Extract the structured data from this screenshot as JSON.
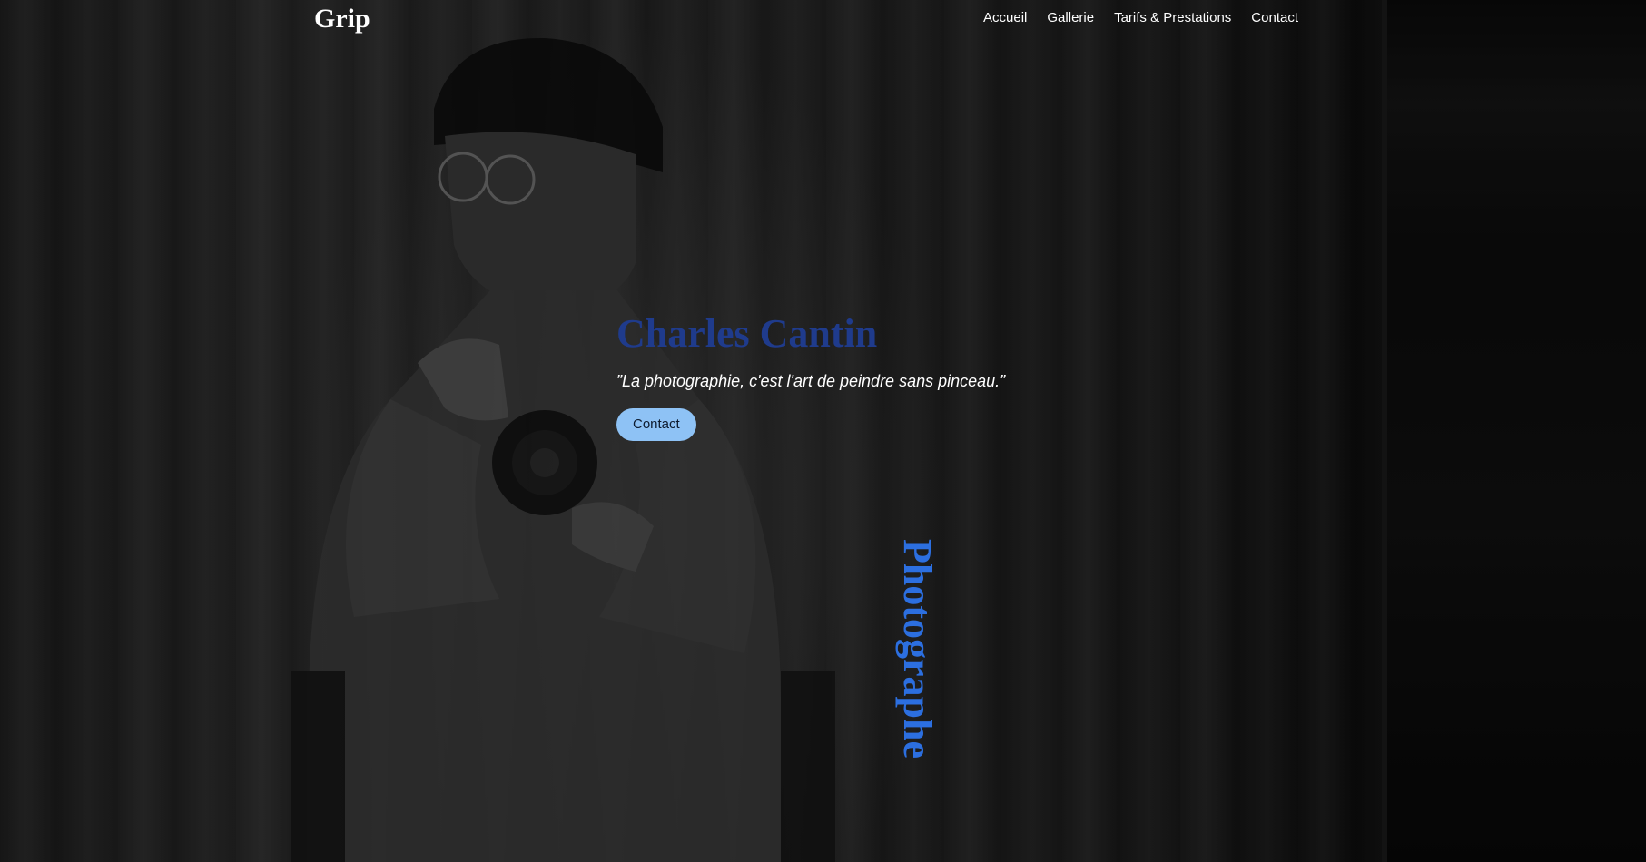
{
  "site": {
    "logo": "Grip"
  },
  "nav": {
    "items": [
      {
        "label": "Accueil"
      },
      {
        "label": "Gallerie"
      },
      {
        "label": "Tarifs & Prestations"
      },
      {
        "label": "Contact"
      }
    ]
  },
  "hero": {
    "name": "Charles Cantin",
    "quote": "”La photographie, c'est l'art de peindre sans pinceau.”",
    "button_label": "Contact",
    "vertical_label": "Photographe"
  },
  "colors": {
    "name": "#1f3b8c",
    "vertical_label": "#2c6fe0",
    "button_bg": "#8ec2f5",
    "background": "#1e1e1e"
  }
}
